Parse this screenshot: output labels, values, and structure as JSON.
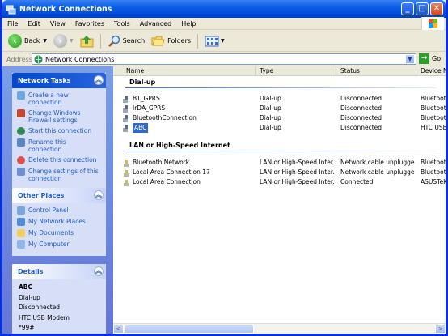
{
  "window": {
    "title": "Network Connections"
  },
  "title_buttons": {
    "minimize": "_",
    "maximize": "□",
    "close": "✕"
  },
  "menu": [
    "File",
    "Edit",
    "View",
    "Favorites",
    "Tools",
    "Advanced",
    "Help"
  ],
  "toolbar": {
    "back": "Back",
    "search": "Search",
    "folders": "Folders"
  },
  "address": {
    "label": "Address",
    "value": "Network Connections",
    "go": "Go"
  },
  "sidebar": {
    "network_tasks": {
      "title": "Network Tasks",
      "items": [
        "Create a new connection",
        "Change Windows Firewall settings",
        "Start this connection",
        "Rename this connection",
        "Delete this connection",
        "Change settings of this connection"
      ]
    },
    "other_places": {
      "title": "Other Places",
      "items": [
        "Control Panel",
        "My Network Places",
        "My Documents",
        "My Computer"
      ]
    },
    "details": {
      "title": "Details",
      "name": "ABC",
      "type": "Dial-up",
      "status": "Disconnected",
      "device": "HTC USB Modem",
      "phone": "*99#"
    }
  },
  "columns": [
    "Name",
    "Type",
    "Status",
    "Device Na"
  ],
  "groups": [
    {
      "title": "Dial-up",
      "rows": [
        {
          "name": "BT_GPRS",
          "type": "Dial-up",
          "status": "Disconnected",
          "device": "Bluetooth"
        },
        {
          "name": "IrDA_GPRS",
          "type": "Dial-up",
          "status": "Disconnected",
          "device": "Bluetooth"
        },
        {
          "name": "BluetoothConnection",
          "type": "Dial-up",
          "status": "Disconnected",
          "device": "Bluetooth"
        },
        {
          "name": "ABC",
          "type": "Dial-up",
          "status": "Disconnected",
          "device": "HTC USB M",
          "selected": true
        }
      ]
    },
    {
      "title": "LAN or High-Speed Internet",
      "rows": [
        {
          "name": "Bluetooth Network",
          "type": "LAN or High-Speed Inter...",
          "status": "Network cable unplugged",
          "device": "Bluetooth"
        },
        {
          "name": "Local Area Connection 17",
          "type": "LAN or High-Speed Inter...",
          "status": "Network cable unplugged",
          "device": "Bluetooth"
        },
        {
          "name": "Local Area Connection",
          "type": "LAN or High-Speed Inter...",
          "status": "Connected",
          "device": "ASUSTeK/"
        }
      ]
    }
  ],
  "scroll": {
    "left": "<",
    "right": ">"
  }
}
